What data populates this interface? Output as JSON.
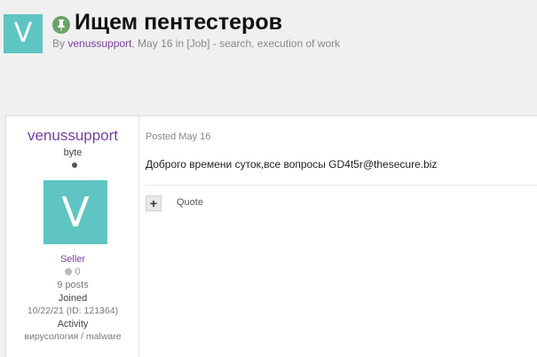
{
  "topic": {
    "avatar_letter": "V",
    "title": "Ищем пентестеров",
    "meta_by": "By ",
    "author": "venussupport",
    "meta_rest": ", May 16 in [Job] - search, execution of work",
    "pin_icon": "pin-icon"
  },
  "post": {
    "author": {
      "name": "venussupport",
      "title": "byte",
      "avatar_letter": "V",
      "group": "Seller",
      "reputation": "0",
      "posts": "9 posts",
      "joined_label": "Joined",
      "joined_value": "10/22/21 (ID: 121364)",
      "activity_label": "Activity",
      "activity_value": "вирусология / malware"
    },
    "posted": "Posted May 16",
    "content": "Доброго времени суток,все вопросы GD4t5r@thesecure.biz",
    "multiquote_symbol": "+",
    "quote_label": "Quote"
  },
  "colors": {
    "avatar_bg": "#5ec5c2",
    "author_link": "#7a3ea3",
    "pin_badge": "#6aa36a"
  }
}
